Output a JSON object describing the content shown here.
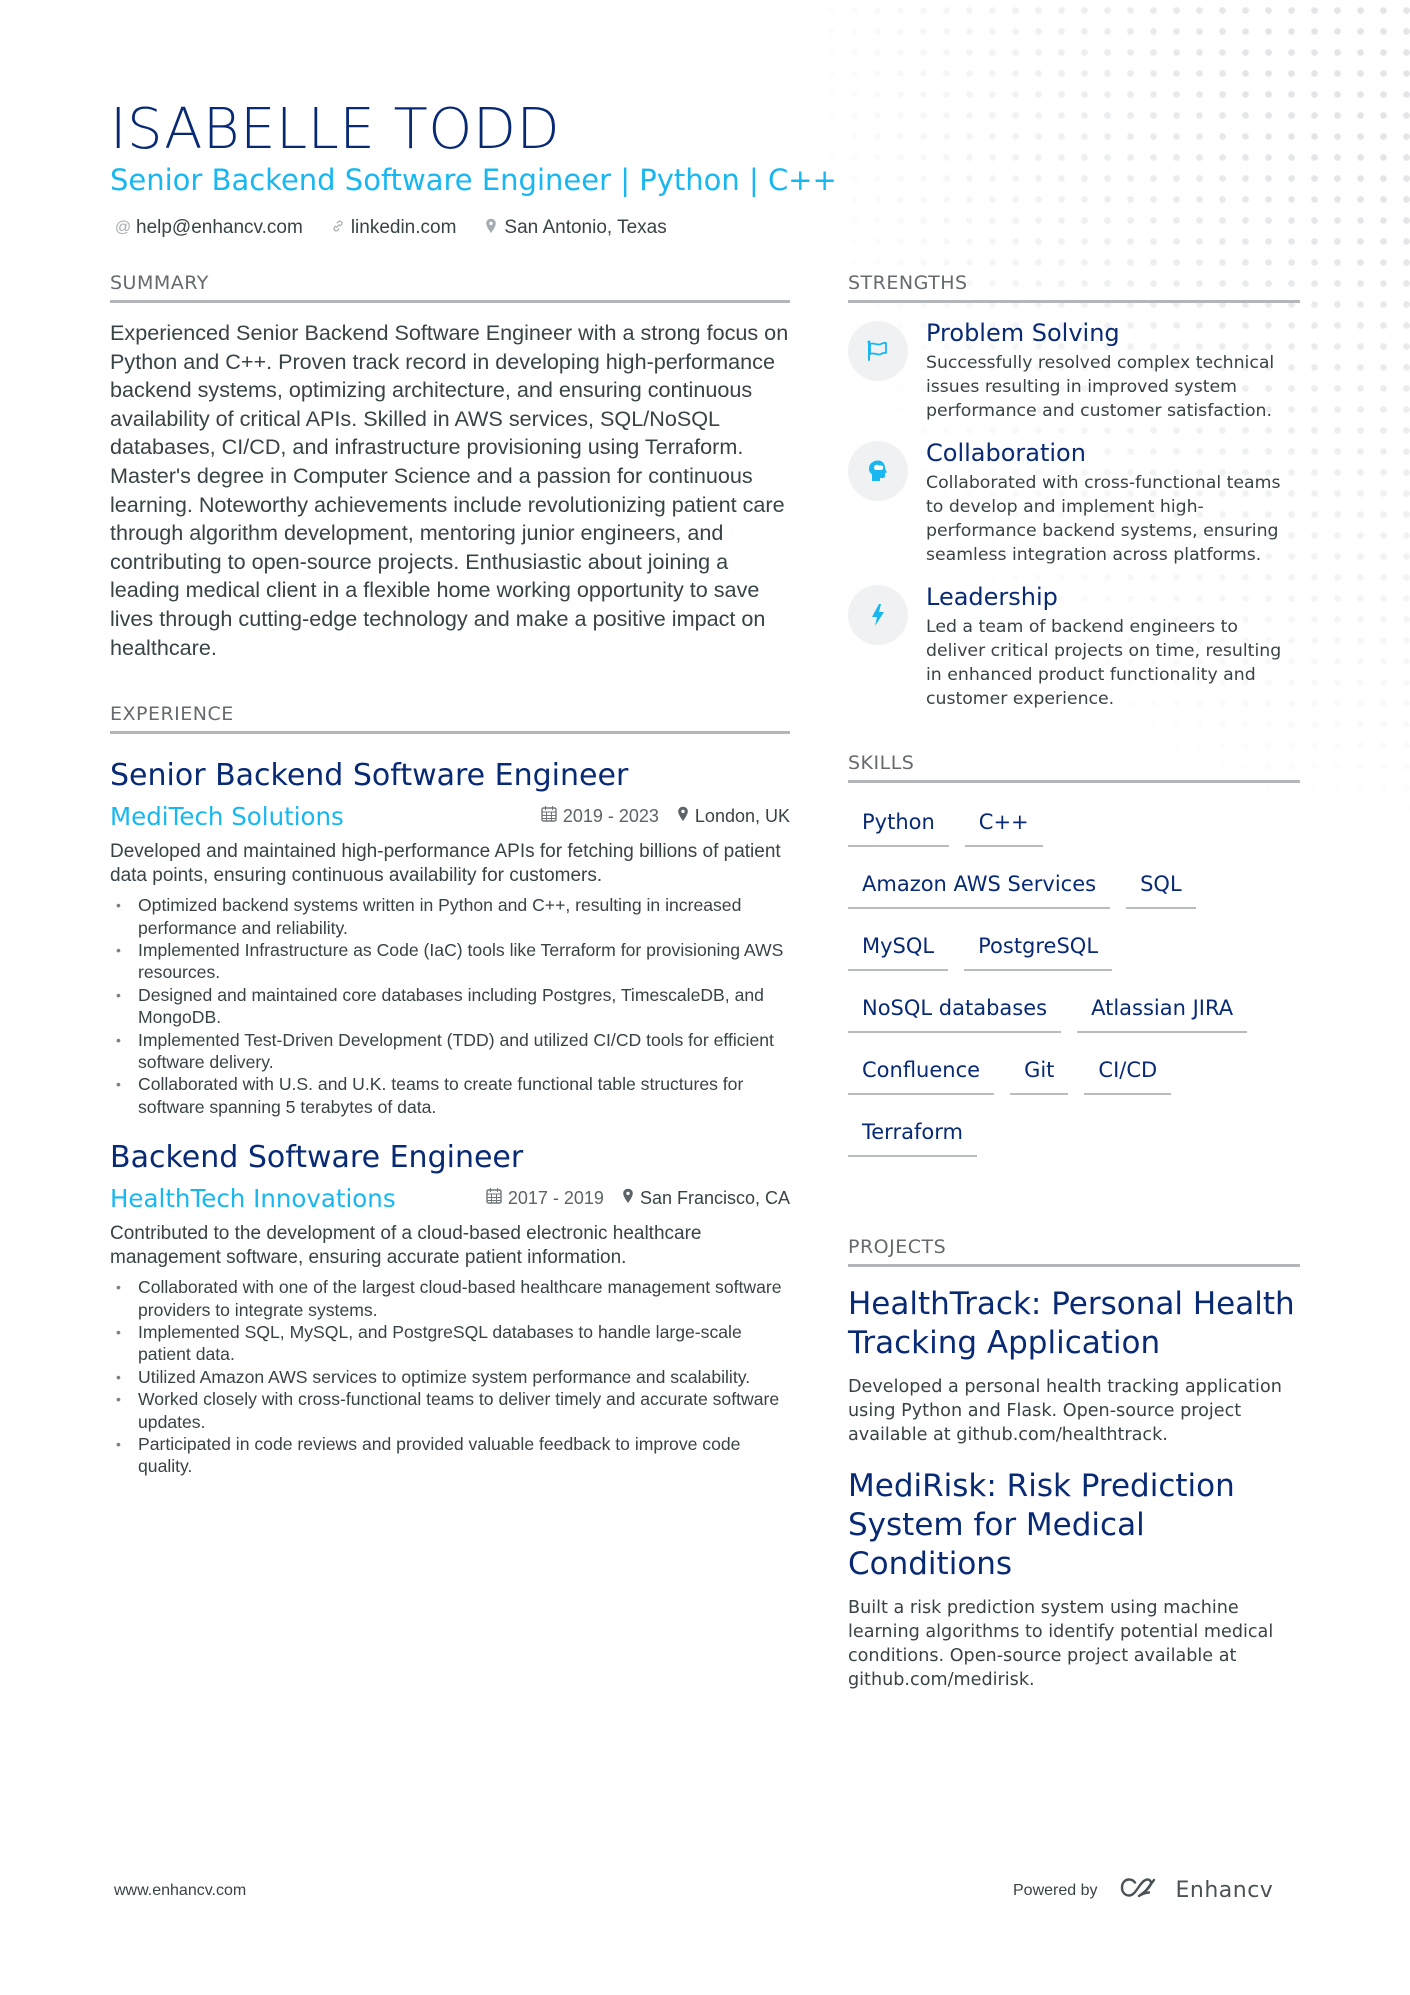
{
  "header": {
    "name": "ISABELLE TODD",
    "headline": "Senior Backend Software Engineer | Python | C++",
    "contacts": [
      {
        "icon": "at-icon",
        "glyph": "@",
        "label": "help@enhancv.com"
      },
      {
        "icon": "link-icon",
        "glyph": "🔗",
        "label": "linkedin.com"
      },
      {
        "icon": "location-pin-icon",
        "glyph": "📍",
        "label": "San Antonio, Texas"
      }
    ]
  },
  "summary": {
    "title": "SUMMARY",
    "text": "Experienced Senior Backend Software Engineer with a strong focus on Python and C++. Proven track record in developing high-performance backend systems, optimizing architecture, and ensuring continuous availability of critical APIs. Skilled in AWS services, SQL/NoSQL databases, CI/CD, and infrastructure provisioning using Terraform. Master's degree in Computer Science and a passion for continuous learning. Noteworthy achievements include revolutionizing patient care through algorithm development, mentoring junior engineers, and contributing to open-source projects. Enthusiastic about joining a leading medical client in a flexible home working opportunity to save lives through cutting-edge technology and make a positive impact on healthcare."
  },
  "experience": {
    "title": "EXPERIENCE",
    "jobs": [
      {
        "title": "Senior Backend Software Engineer",
        "company": "MediTech Solutions",
        "dates": "2019 - 2023",
        "location": "London, UK",
        "description": "Developed and maintained high-performance APIs for fetching billions of patient data points, ensuring continuous availability for customers.",
        "bullets": [
          "Optimized backend systems written in Python and C++, resulting in increased performance and reliability.",
          "Implemented Infrastructure as Code (IaC) tools like Terraform for provisioning AWS resources.",
          "Designed and maintained core databases including Postgres, TimescaleDB, and MongoDB.",
          "Implemented Test-Driven Development (TDD) and utilized CI/CD tools for efficient software delivery.",
          "Collaborated with U.S. and U.K. teams to create functional table structures for software spanning 5 terabytes of data."
        ]
      },
      {
        "title": "Backend Software Engineer",
        "company": "HealthTech Innovations",
        "dates": "2017 - 2019",
        "location": "San Francisco, CA",
        "description": "Contributed to the development of a cloud-based electronic healthcare management software, ensuring accurate patient information.",
        "bullets": [
          "Collaborated with one of the largest cloud-based healthcare management software providers to integrate systems.",
          "Implemented SQL, MySQL, and PostgreSQL databases to handle large-scale patient data.",
          "Utilized Amazon AWS services to optimize system performance and scalability.",
          "Worked closely with cross-functional teams to deliver timely and accurate software updates.",
          "Participated in code reviews and provided valuable feedback to improve code quality."
        ]
      }
    ]
  },
  "strengths": {
    "title": "STRENGTHS",
    "items": [
      {
        "icon": "flag-icon",
        "title": "Problem Solving",
        "description": "Successfully resolved complex technical issues resulting in improved system performance and customer satisfaction."
      },
      {
        "icon": "head-brain-icon",
        "title": "Collaboration",
        "description": "Collaborated with cross-functional teams to develop and implement high-performance backend systems, ensuring seamless integration across platforms."
      },
      {
        "icon": "lightning-bolt-icon",
        "title": "Leadership",
        "description": "Led a team of backend engineers to deliver critical projects on time, resulting in enhanced product functionality and customer experience."
      }
    ]
  },
  "skills": {
    "title": "SKILLS",
    "items": [
      "Python",
      "C++",
      "Amazon AWS Services",
      "SQL",
      "MySQL",
      "PostgreSQL",
      "NoSQL databases",
      "Atlassian JIRA",
      "Confluence",
      "Git",
      "CI/CD",
      "Terraform"
    ]
  },
  "projects": {
    "title": "PROJECTS",
    "items": [
      {
        "title": "HealthTrack: Personal Health Tracking Application",
        "description": "Developed a personal health tracking application using Python and Flask. Open-source project available at github.com/healthtrack."
      },
      {
        "title": "MediRisk: Risk Prediction System for Medical Conditions",
        "description": "Built a risk prediction system using machine learning algorithms to identify potential medical conditions. Open-source project available at github.com/medirisk."
      }
    ]
  },
  "footer": {
    "website": "www.enhancv.com",
    "powered_by": "Powered by",
    "brand": "Enhancv"
  },
  "colors": {
    "name": "#082a75",
    "accent": "#18b7f0",
    "text": "#384347",
    "rule": "#b2b6ba"
  }
}
